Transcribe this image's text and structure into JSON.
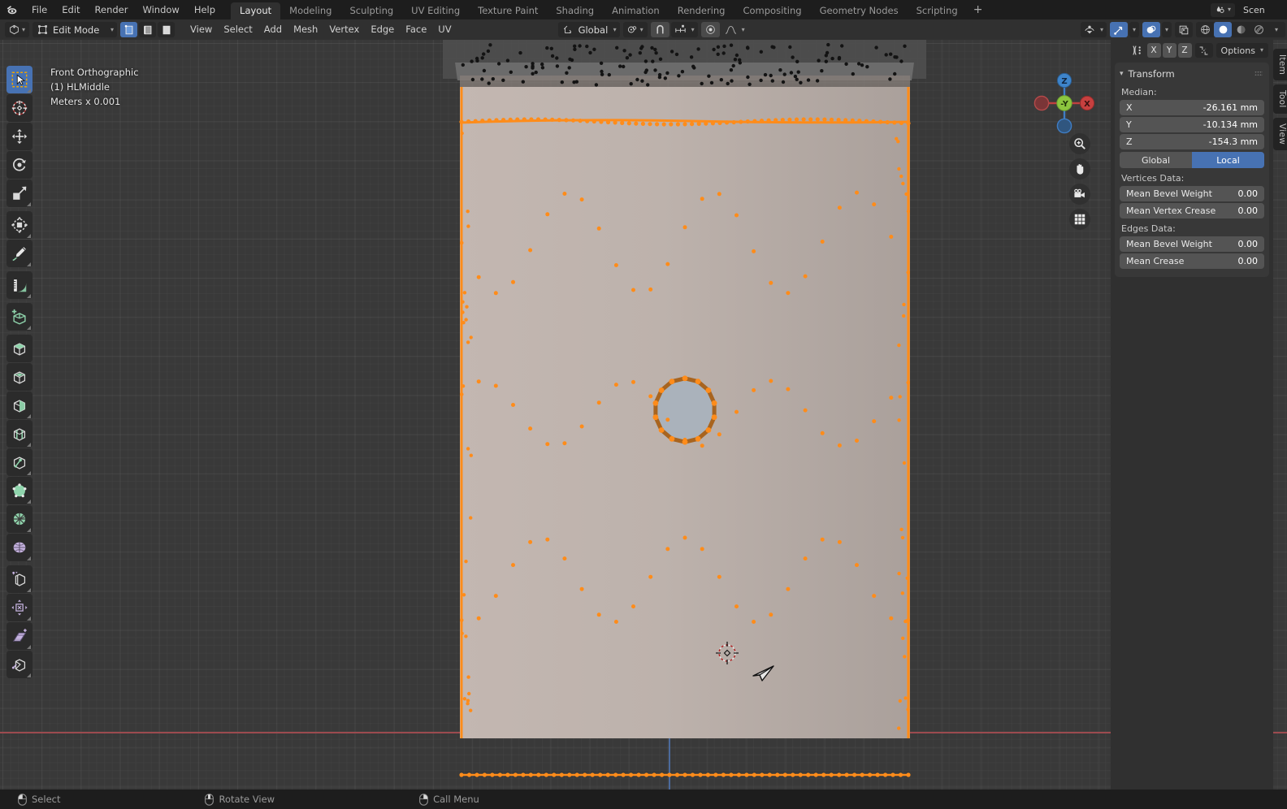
{
  "app": {
    "title": "Blender",
    "logo_icon": "blender-logo-icon"
  },
  "topbar": {
    "menus": [
      "File",
      "Edit",
      "Render",
      "Window",
      "Help"
    ],
    "workspaces": [
      {
        "label": "Layout",
        "active": true
      },
      {
        "label": "Modeling",
        "active": false
      },
      {
        "label": "Sculpting",
        "active": false
      },
      {
        "label": "UV Editing",
        "active": false
      },
      {
        "label": "Texture Paint",
        "active": false
      },
      {
        "label": "Shading",
        "active": false
      },
      {
        "label": "Animation",
        "active": false
      },
      {
        "label": "Rendering",
        "active": false
      },
      {
        "label": "Compositing",
        "active": false
      },
      {
        "label": "Geometry Nodes",
        "active": false
      },
      {
        "label": "Scripting",
        "active": false
      }
    ],
    "add_workspace_label": "+",
    "scene_icon": "scene-icon",
    "scene_name": "Scen"
  },
  "viewport_header": {
    "editor_type_icon": "editor-type-3dview-icon",
    "mode": "Edit Mode",
    "select_modes": [
      {
        "name": "vertex-select-mode",
        "active": true
      },
      {
        "name": "edge-select-mode",
        "active": false
      },
      {
        "name": "face-select-mode",
        "active": false
      }
    ],
    "menus": [
      "View",
      "Select",
      "Add",
      "Mesh",
      "Vertex",
      "Edge",
      "Face",
      "UV"
    ],
    "transform_orientation": "Global",
    "pivot_icon": "pivot-point-icon",
    "snap_icon": "snap-magnet-icon",
    "snap_target_icon": "snap-increment-icon",
    "proportional_edit_icon": "proportional-edit-icon",
    "proportional_falloff_icon": "falloff-smooth-icon",
    "right_icons": [
      {
        "name": "visibility-selectability-icon",
        "active": false
      },
      {
        "name": "gizmo-icon",
        "active": true
      },
      {
        "name": "overlays-icon",
        "active": true
      },
      {
        "name": "xray-toggle-icon",
        "active": false
      }
    ],
    "shading_modes": [
      {
        "name": "wireframe-shading",
        "active": false
      },
      {
        "name": "solid-shading",
        "active": true
      },
      {
        "name": "material-preview-shading",
        "active": false
      },
      {
        "name": "rendered-shading",
        "active": false
      }
    ]
  },
  "viewport": {
    "view_name": "Front Orthographic",
    "object_name": "(1) HLMiddle",
    "unit_scale": "Meters x 0.001",
    "gizmo": {
      "axes": [
        {
          "label": "Z",
          "name": "gizmo-axis-z-pos"
        },
        {
          "label": "-Y",
          "name": "gizmo-axis-y-neg"
        },
        {
          "label": "X",
          "name": "gizmo-axis-x-pos"
        }
      ]
    },
    "nav_buttons": [
      {
        "name": "zoom-view-icon"
      },
      {
        "name": "move-view-icon"
      },
      {
        "name": "camera-view-icon"
      },
      {
        "name": "toggle-orthographic-icon"
      }
    ],
    "cursor_3d_name": "3d-cursor",
    "mouse_cursor_name": "mouse-cursor"
  },
  "toolbar": {
    "tools": [
      {
        "name": "tool-tweak",
        "icon": "select-box-icon",
        "active": true,
        "group": false
      },
      {
        "name": "tool-cursor",
        "icon": "cursor-icon",
        "active": false,
        "group": false
      },
      {
        "name": "tool-move",
        "icon": "move-icon",
        "active": false,
        "group": false
      },
      {
        "name": "tool-rotate",
        "icon": "rotate-icon",
        "active": false,
        "group": false
      },
      {
        "name": "tool-scale",
        "icon": "scale-icon",
        "active": false,
        "group": true
      },
      {
        "name": "tool-transform",
        "icon": "transform-icon",
        "active": false,
        "group": false
      },
      {
        "name": "tool-annotate",
        "icon": "annotate-icon",
        "active": false,
        "group": true
      },
      {
        "name": "tool-measure",
        "icon": "measure-icon",
        "active": false,
        "group": true
      },
      {
        "name": "tool-add-cube",
        "icon": "add-cube-icon",
        "active": false,
        "group": true
      },
      {
        "name": "tool-extrude-region",
        "icon": "extrude-region-icon",
        "active": false,
        "group": false
      },
      {
        "name": "tool-inset-faces",
        "icon": "inset-faces-icon",
        "active": false,
        "group": false
      },
      {
        "name": "tool-bevel",
        "icon": "bevel-icon",
        "active": false,
        "group": false
      },
      {
        "name": "tool-loop-cut",
        "icon": "loop-cut-icon",
        "active": false,
        "group": false
      },
      {
        "name": "tool-knife",
        "icon": "knife-icon",
        "active": false,
        "group": false
      },
      {
        "name": "tool-poly-build",
        "icon": "poly-build-icon",
        "active": false,
        "group": false
      },
      {
        "name": "tool-spin",
        "icon": "spin-icon",
        "active": false,
        "group": false
      },
      {
        "name": "tool-smooth",
        "icon": "smooth-icon",
        "active": false,
        "group": true
      },
      {
        "name": "tool-edge-slide",
        "icon": "edge-slide-icon",
        "active": false,
        "group": false
      },
      {
        "name": "tool-shrink-fatten",
        "icon": "shrink-fatten-icon",
        "active": false,
        "group": false
      },
      {
        "name": "tool-shear",
        "icon": "shear-icon",
        "active": false,
        "group": false
      },
      {
        "name": "tool-rip-region",
        "icon": "rip-region-icon",
        "active": false,
        "group": false
      }
    ]
  },
  "sidebar": {
    "header": {
      "snap_icon": "mesh-snap-icon",
      "axis_buttons": [
        "X",
        "Y",
        "Z"
      ],
      "mirror_icon": "mirror-icon",
      "options_label": "Options"
    },
    "tabs": [
      {
        "label": "Item",
        "active": true
      },
      {
        "label": "Tool",
        "active": false
      },
      {
        "label": "View",
        "active": false
      }
    ],
    "transform_panel": {
      "title": "Transform",
      "median_label": "Median:",
      "median": [
        {
          "axis": "X",
          "value": "-26.161 mm"
        },
        {
          "axis": "Y",
          "value": "-10.134 mm"
        },
        {
          "axis": "Z",
          "value": "-154.3 mm"
        }
      ],
      "space_toggle": [
        {
          "label": "Global",
          "active": false
        },
        {
          "label": "Local",
          "active": true
        }
      ],
      "vertices_data_label": "Vertices Data:",
      "vertices_data": [
        {
          "label": "Mean Bevel Weight",
          "value": "0.00"
        },
        {
          "label": "Mean Vertex Crease",
          "value": "0.00"
        }
      ],
      "edges_data_label": "Edges Data:",
      "edges_data": [
        {
          "label": "Mean Bevel Weight",
          "value": "0.00"
        },
        {
          "label": "Mean Crease",
          "value": "0.00"
        }
      ]
    }
  },
  "statusbar": {
    "hints": [
      {
        "icon": "mouse-left-icon",
        "label": "Select"
      },
      {
        "icon": "mouse-middle-icon",
        "label": "Rotate View"
      },
      {
        "icon": "mouse-right-icon",
        "label": "Call Menu"
      }
    ]
  },
  "colors": {
    "accent_blue": "#4772b3",
    "selection_orange": "#ff8c1a",
    "edge_orange": "#cf7a2e",
    "mesh_face": "#b6aba5",
    "background": "#393939",
    "panel": "#303030",
    "axis_x_red": "#9c4b4f",
    "axis_z_blue": "#4b6a9c"
  }
}
